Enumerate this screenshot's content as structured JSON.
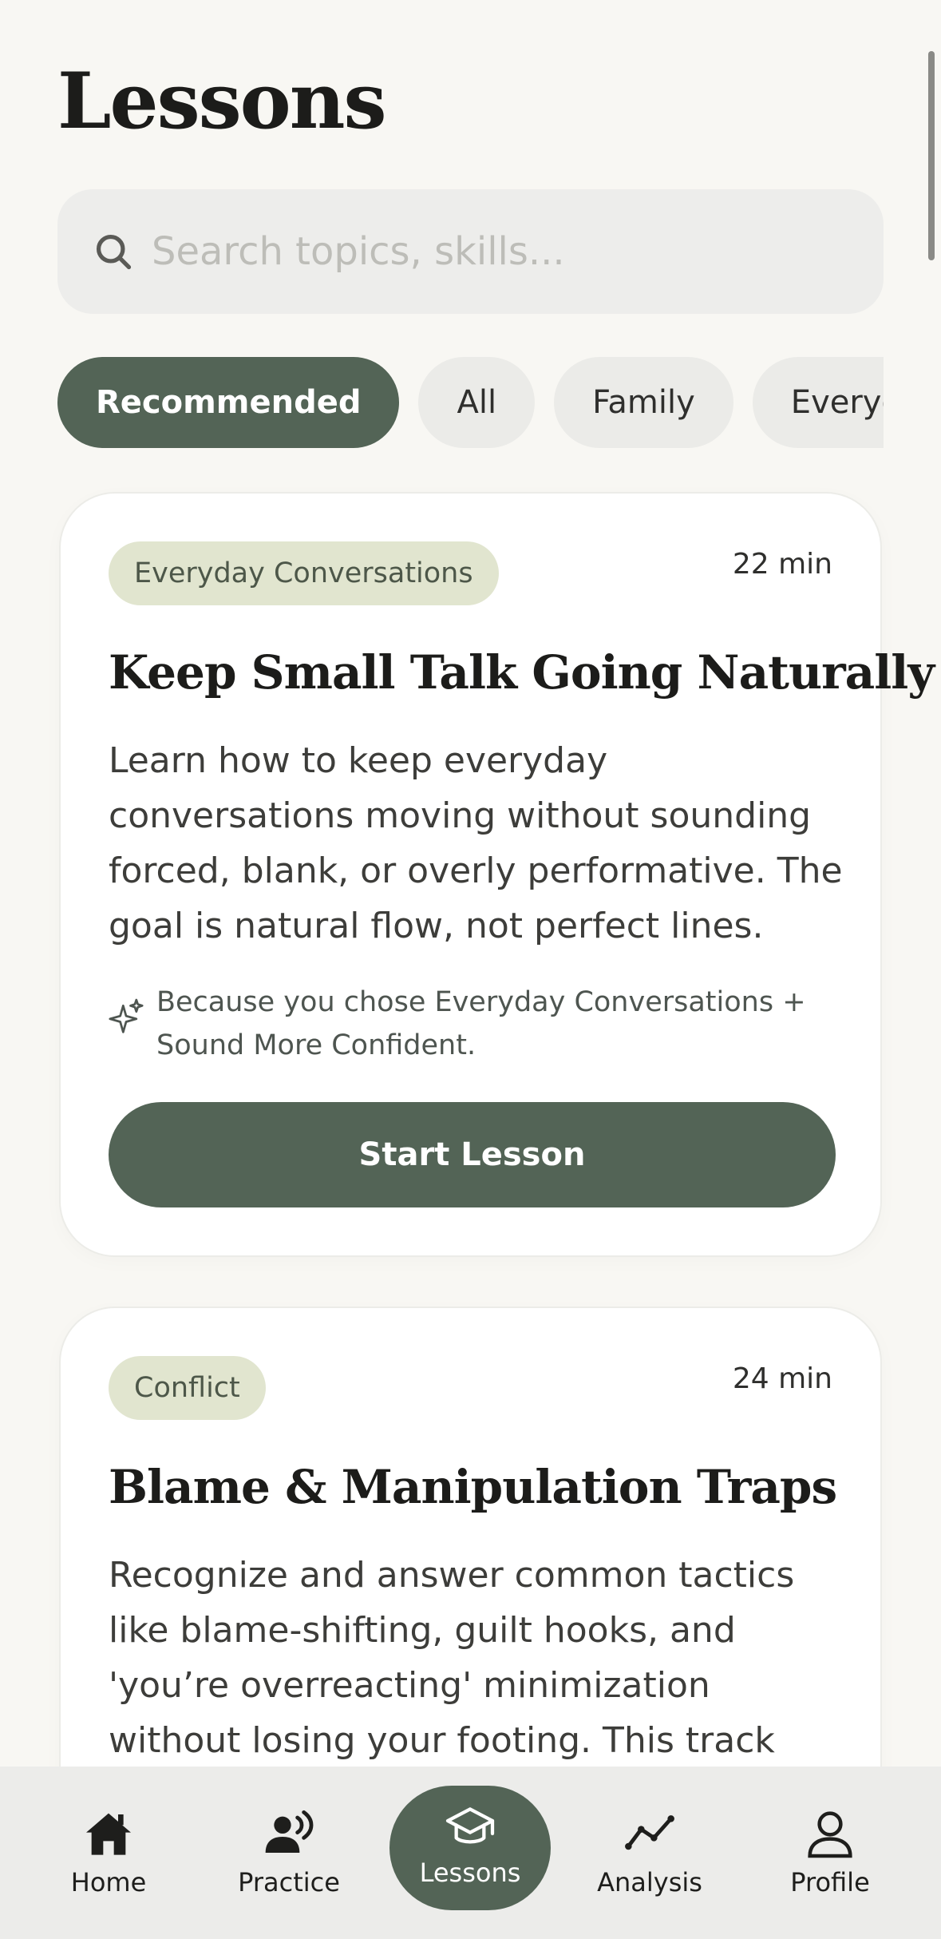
{
  "page": {
    "title": "Lessons"
  },
  "search": {
    "placeholder": "Search topics, skills...",
    "value": ""
  },
  "filters": [
    {
      "label": "Recommended",
      "selected": true
    },
    {
      "label": "All",
      "selected": false
    },
    {
      "label": "Family",
      "selected": false
    },
    {
      "label": "Everyday",
      "selected": false
    }
  ],
  "lessons": [
    {
      "tag": "Everyday Conversations",
      "duration": "22 min",
      "title": "Keep Small Talk Going Naturally",
      "description": "Learn how to keep everyday conversations moving without sounding forced, blank, or overly performative. The goal is natural flow, not perfect lines.",
      "reason": "Because you chose Everyday Conversations + Sound More Confident.",
      "button": "Start Lesson"
    },
    {
      "tag": "Conflict",
      "duration": "24 min",
      "title": "Blame & Manipulation Traps",
      "description": "Recognize and answer common tactics like blame-shifting, guilt hooks, and 'you’re overreacting' minimization without losing your footing. This track helps you stay clear"
    }
  ],
  "nav": [
    {
      "label": "Home",
      "icon": "home-icon",
      "active": false
    },
    {
      "label": "Practice",
      "icon": "speaking-person-icon",
      "active": false
    },
    {
      "label": "Lessons",
      "icon": "graduation-cap-icon",
      "active": true
    },
    {
      "label": "Analysis",
      "icon": "trend-line-icon",
      "active": false
    },
    {
      "label": "Profile",
      "icon": "person-icon",
      "active": false
    }
  ],
  "colors": {
    "accent": "#536456",
    "tag_background": "#e1e5cf",
    "page_background": "#f8f7f3"
  }
}
